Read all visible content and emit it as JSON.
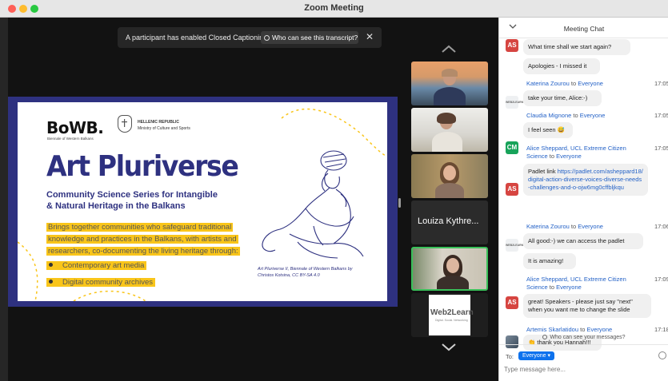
{
  "window": {
    "title": "Zoom Meeting"
  },
  "caption_banner": {
    "text": "A participant has enabled Closed Captioning",
    "button_label": "Who can see this transcript?",
    "close_symbol": "✕"
  },
  "slide": {
    "logo": "BoWB.",
    "logo_sub": "Biennale of Western Balkans",
    "hellenic_line1": "HELLENIC REPUBLIC",
    "hellenic_line2": "Ministry of Culture and Sports",
    "title": "Art Pluriverse",
    "subtitle_line1": "Community Science Series for Intangible",
    "subtitle_line2": "& Natural Heritage in the Balkans",
    "body_line1": "Brings together communities who safeguard traditional",
    "body_line2": "knowledge and practices in the Balkans, with artists and",
    "body_line3": "researchers, co-documenting the living heritage through:",
    "bullets": [
      "Contemporary art media",
      "Digital community archives"
    ],
    "credit_line1": "Art Pluriverse II, Biennale of Western Balkans by",
    "credit_line2": "Christos Kotsina, CC BY-SA 4.0",
    "brand_color": "#2e3180",
    "highlight_color": "#f9c51a"
  },
  "gallery": {
    "tile4_name": "Louiza Kythre...",
    "web2learn_logo": "Web2Learn",
    "web2learn_tagline": "Digital. Social. Networking",
    "active_speaker_color": "#3ac15a"
  },
  "chat": {
    "title": "Meeting Chat",
    "messages": [
      {
        "avatar": "AS",
        "text": "What time shall we start again?"
      },
      {
        "text": "Apologies - I missed it"
      },
      {
        "avatar": "WEB2LEARN",
        "sender": "Katerina Zourou",
        "to": "to",
        "recipient": "Everyone",
        "time": "17:05",
        "text": "take your time, Alice:-)"
      },
      {
        "avatar": "CM",
        "sender": "Claudia Mignone",
        "to": "to",
        "recipient": "Everyone",
        "time": "17:05",
        "text": "I feel seen 😅"
      },
      {
        "avatar": "AS",
        "sender": "Alice Sheppard, UCL Extreme Citizen Science",
        "to": "to",
        "recipient": "Everyone",
        "time": "17:05",
        "text_prefix": "Padlet link ",
        "link": "https://padlet.com/asheppard18/digital-action-diverse-voices-diverse-needs-challenges-and-o-ojw6mg0cffbljkqu"
      },
      {
        "avatar": "WEB2LEARN",
        "sender": "Katerina Zourou",
        "to": "to",
        "recipient": "Everyone",
        "time": "17:06",
        "text": "All good:-) we can access the padlet"
      },
      {
        "text": "It is amazing!"
      },
      {
        "avatar": "AS",
        "sender": "Alice Sheppard, UCL Extreme Citizen Science",
        "to": "to",
        "recipient": "Everyone",
        "time": "17:09",
        "text": "great! Speakers - please just say \"next\" when you want me to change the slide"
      },
      {
        "avatar": "photo",
        "sender": "Artemis Skarlatidou",
        "to": "to",
        "recipient": "Everyone",
        "time": "17:18",
        "text": "👏 thank you Hannah!!!"
      }
    ],
    "who_can_see": "Who can see your messages?",
    "to_label": "To:",
    "recipient_pill": "Everyone ▾",
    "input_placeholder": "Type message here..."
  }
}
